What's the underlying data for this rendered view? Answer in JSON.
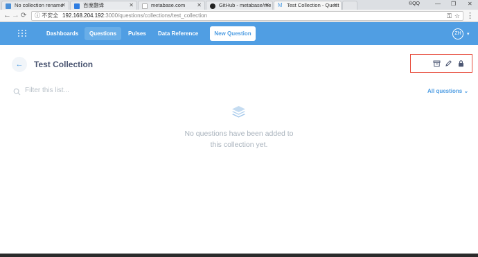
{
  "browser": {
    "tabs": [
      {
        "title": "No collection rename",
        "favicon_color": "#4a8fd8"
      },
      {
        "title": "百度翻译",
        "favicon_color": "#2f7de1"
      },
      {
        "title": "metabase.com",
        "favicon_color": "#d0d0d0"
      },
      {
        "title": "GitHub - metabase/me",
        "favicon_color": "#222222"
      },
      {
        "title": "Test Collection - Quest",
        "favicon_color": "#509ee3"
      }
    ],
    "window_controls": {
      "minimize": "—",
      "maximize": "❐",
      "close": "✕"
    },
    "user_label": "©QQ",
    "address": {
      "security": "ⓘ 不安全",
      "host": "192.168.204.192",
      "path": ":3000/questions/collections/test_collection"
    }
  },
  "appnav": {
    "links": [
      "Dashboards",
      "Questions",
      "Pulses",
      "Data Reference"
    ],
    "active": "Questions",
    "new_question": "New Question",
    "avatar_initials": "ZH"
  },
  "page": {
    "title": "Test Collection",
    "header_icons": [
      "archive-icon",
      "pencil-icon",
      "lock-icon"
    ],
    "filter_placeholder": "Filter this list...",
    "filter_dropdown": "All questions",
    "empty_message_line1": "No questions have been added to",
    "empty_message_line2": "this collection yet."
  },
  "colors": {
    "brand": "#509ee3",
    "title_text": "#4c5773",
    "muted_text": "#a8b2bc",
    "highlight": "#e74c3c"
  }
}
